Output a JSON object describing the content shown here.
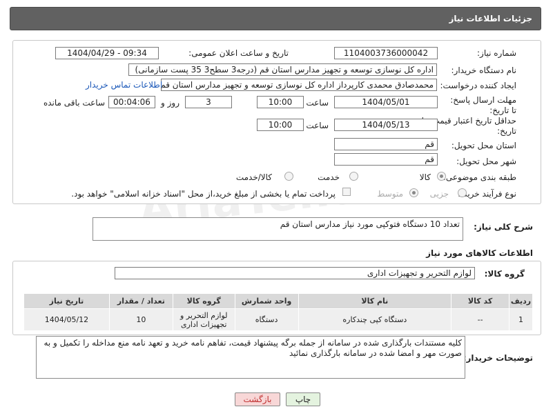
{
  "header": {
    "title": "جزئیات اطلاعات نیاز"
  },
  "form": {
    "need_number_label": "شماره نیاز:",
    "need_number": "1104003736000042",
    "announce_label": "تاریخ و ساعت اعلان عمومی:",
    "announce_value": "1404/04/29 - 09:34",
    "buyer_org_label": "نام دستگاه خریدار:",
    "buyer_org": "اداره کل نوسازی   توسعه و تجهیز مدارس استان قم (درجه3 سطح3  35 پست سازمانی)",
    "requester_label": "ایجاد کننده درخواست:",
    "requester": "محمدصادق محمدی کارپرداز  اداره کل نوسازی   توسعه و تجهیز مدارس استان قم",
    "contact_link": "اطلاعات تماس خریدار",
    "deadline_label": "مهلت ارسال پاسخ: تا تاریخ:",
    "deadline_date": "1404/05/01",
    "time_label": "ساعت",
    "deadline_time": "10:00",
    "days_value": "3",
    "days_label": "روز و",
    "remaining_time": "00:04:06",
    "remaining_label": "ساعت باقی مانده",
    "price_validity_label": "حداقل تاریخ اعتبار قیمت: تا تاریخ:",
    "price_date": "1404/05/13",
    "price_time": "10:00",
    "province_label": "استان محل تحویل:",
    "province": "قم",
    "city_label": "شهر محل تحویل:",
    "city": "قم",
    "category_label": "طبقه بندی موضوعی:",
    "category_options": [
      "کالا",
      "خدمت",
      "کالا/خدمت"
    ],
    "process_label": "نوع فرآیند خرید :",
    "process_options": [
      "جزیی",
      "متوسط"
    ],
    "payment_note": "پرداخت تمام یا بخشی از مبلغ خرید،از محل \"اسناد خزانه اسلامی\" خواهد بود."
  },
  "description": {
    "label": "شرح کلی نیاز:",
    "text": "تعداد 10 دستگاه فتوکپی مورد نیاز مدارس استان قم"
  },
  "goods": {
    "section_title": "اطلاعات کالاهای مورد نیاز",
    "group_label": "گروه کالا:",
    "group_value": "لوازم التحریر و تجهیزات اداری",
    "columns": [
      "ردیف",
      "کد کالا",
      "نام کالا",
      "واحد شمارش",
      "گروه کالا",
      "تعداد / مقدار",
      "تاریخ نیاز"
    ],
    "rows": [
      [
        "1",
        "--",
        "دستگاه کپی چندکاره",
        "دستگاه",
        "لوازم التحریر و تجهیزات اداری",
        "10",
        "1404/05/12"
      ]
    ]
  },
  "buyer_notes": {
    "label": "توضیحات خریدار:",
    "text": "کلیه مستندات بارگذاری شده در سامانه از جمله برگه پیشنهاد قیمت، تفاهم نامه خرید و تعهد نامه منع مداخله را تکمیل و به صورت مهر و امضا شده در سامانه بارگذاری نمائید"
  },
  "buttons": {
    "print": "چاپ",
    "back": "بازگشت"
  },
  "watermark": "AriaTender.neT",
  "colors": {
    "header_bg": "#616161",
    "link": "#1a57b8",
    "back_btn_bg": "#f8d7d7",
    "print_btn_bg": "#e4f3df"
  }
}
